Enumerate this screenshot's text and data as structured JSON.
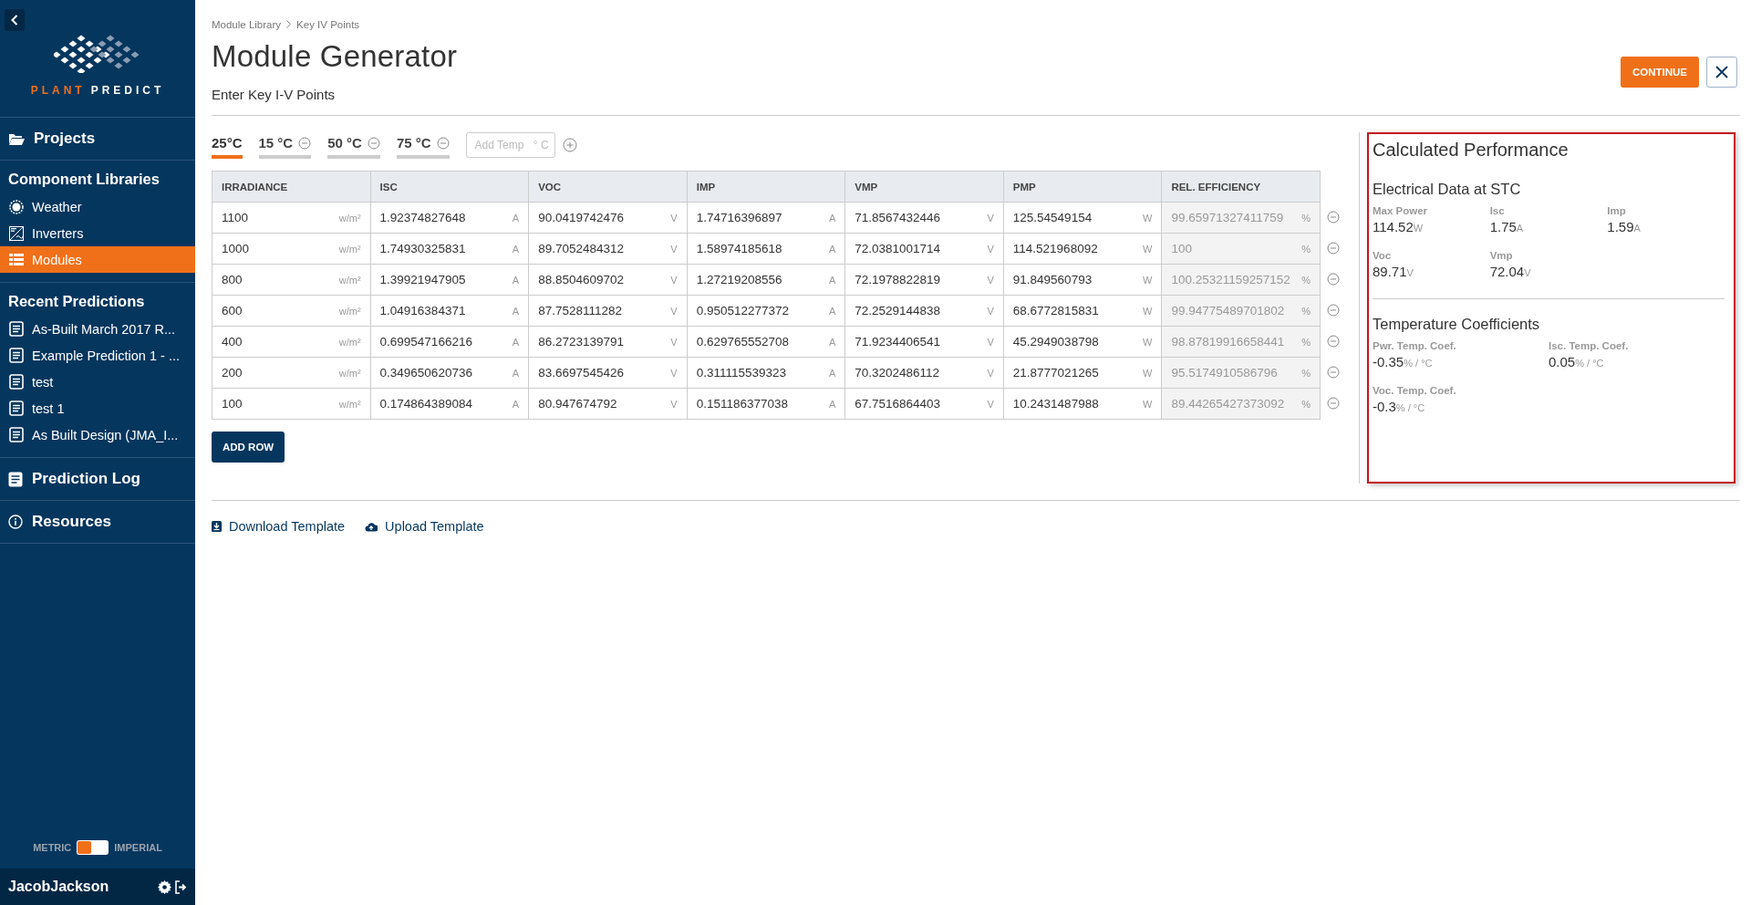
{
  "sidebar": {
    "logo": {
      "first": "PLANT",
      "second": "PREDICT"
    },
    "sections": [
      {
        "kind": "link",
        "label": "Projects",
        "selected": false
      },
      {
        "kind": "group",
        "label": "Component Libraries",
        "items": [
          {
            "label": "Weather",
            "selected": false
          },
          {
            "label": "Inverters",
            "selected": false
          },
          {
            "label": "Modules",
            "selected": true
          }
        ]
      },
      {
        "kind": "group",
        "label": "Recent Predictions",
        "items": [
          {
            "label": "As-Built March 2017 R...",
            "selected": false
          },
          {
            "label": "Example Prediction 1 - ...",
            "selected": false
          },
          {
            "label": "test",
            "selected": false
          },
          {
            "label": "test 1",
            "selected": false
          },
          {
            "label": "As Built Design (JMA_I...",
            "selected": false
          }
        ]
      },
      {
        "kind": "link",
        "label": "Prediction Log",
        "selected": false
      },
      {
        "kind": "link",
        "label": "Resources",
        "selected": false
      }
    ],
    "units": {
      "left_label": "METRIC",
      "right_label": "IMPERIAL",
      "imperial": false
    },
    "user": "JacobJackson"
  },
  "breadcrumb": [
    "Module Library",
    "Key IV Points"
  ],
  "title": "Module Generator",
  "subtitle": "Enter Key I-V Points",
  "continue_button": "CONTINUE",
  "temperature_tabs": [
    {
      "label": "25°C",
      "selected": true,
      "removable": false
    },
    {
      "label": "15 °C",
      "selected": false,
      "removable": true
    },
    {
      "label": "50 °C",
      "selected": false,
      "removable": true
    },
    {
      "label": "75 °C",
      "selected": false,
      "removable": true
    }
  ],
  "add_temp": {
    "placeholder": "Add Temp",
    "suffix": "° C"
  },
  "table": {
    "columns": [
      {
        "label": "IRRADIANCE",
        "readonly": false
      },
      {
        "label": "ISC",
        "readonly": false
      },
      {
        "label": "VOC",
        "readonly": false
      },
      {
        "label": "IMP",
        "readonly": false
      },
      {
        "label": "VMP",
        "readonly": false
      },
      {
        "label": "PMP",
        "readonly": false
      },
      {
        "label": "REL. EFFICIENCY",
        "readonly": true
      }
    ],
    "rows": [
      [
        {
          "value": "1100",
          "unit": "w/m²"
        },
        {
          "value": "1.92374827648",
          "unit": "A"
        },
        {
          "value": "90.0419742476",
          "unit": "V"
        },
        {
          "value": "1.74716396897",
          "unit": "A"
        },
        {
          "value": "71.8567432446",
          "unit": "V"
        },
        {
          "value": "125.54549154",
          "unit": "W"
        },
        {
          "value": "99.65971327411759",
          "unit": "%"
        }
      ],
      [
        {
          "value": "1000",
          "unit": "w/m²"
        },
        {
          "value": "1.74930325831",
          "unit": "A"
        },
        {
          "value": "89.7052484312",
          "unit": "V"
        },
        {
          "value": "1.58974185618",
          "unit": "A"
        },
        {
          "value": "72.0381001714",
          "unit": "V"
        },
        {
          "value": "114.521968092",
          "unit": "W"
        },
        {
          "value": "100",
          "unit": "%"
        }
      ],
      [
        {
          "value": "800",
          "unit": "w/m²"
        },
        {
          "value": "1.39921947905",
          "unit": "A"
        },
        {
          "value": "88.8504609702",
          "unit": "V"
        },
        {
          "value": "1.27219208556",
          "unit": "A"
        },
        {
          "value": "72.1978822819",
          "unit": "V"
        },
        {
          "value": "91.849560793",
          "unit": "W"
        },
        {
          "value": "100.25321159257152",
          "unit": "%"
        }
      ],
      [
        {
          "value": "600",
          "unit": "w/m²"
        },
        {
          "value": "1.04916384371",
          "unit": "A"
        },
        {
          "value": "87.7528111282",
          "unit": "V"
        },
        {
          "value": "0.950512277372",
          "unit": "A"
        },
        {
          "value": "72.2529144838",
          "unit": "V"
        },
        {
          "value": "68.6772815831",
          "unit": "W"
        },
        {
          "value": "99.94775489701802",
          "unit": "%"
        }
      ],
      [
        {
          "value": "400",
          "unit": "w/m²"
        },
        {
          "value": "0.699547166216",
          "unit": "A"
        },
        {
          "value": "86.2723139791",
          "unit": "V"
        },
        {
          "value": "0.629765552708",
          "unit": "A"
        },
        {
          "value": "71.9234406541",
          "unit": "V"
        },
        {
          "value": "45.2949038798",
          "unit": "W"
        },
        {
          "value": "98.87819916658441",
          "unit": "%"
        }
      ],
      [
        {
          "value": "200",
          "unit": "w/m²"
        },
        {
          "value": "0.349650620736",
          "unit": "A"
        },
        {
          "value": "83.6697545426",
          "unit": "V"
        },
        {
          "value": "0.311115539323",
          "unit": "A"
        },
        {
          "value": "70.3202486112",
          "unit": "V"
        },
        {
          "value": "21.8777021265",
          "unit": "W"
        },
        {
          "value": "95.5174910586796",
          "unit": "%"
        }
      ],
      [
        {
          "value": "100",
          "unit": "w/m²"
        },
        {
          "value": "0.174864389084",
          "unit": "A"
        },
        {
          "value": "80.947674792",
          "unit": "V"
        },
        {
          "value": "0.151186377038",
          "unit": "A"
        },
        {
          "value": "67.7516864403",
          "unit": "V"
        },
        {
          "value": "10.2431487988",
          "unit": "W"
        },
        {
          "value": "89.44265427373092",
          "unit": "%"
        }
      ]
    ]
  },
  "add_row_button": "ADD ROW",
  "links": [
    "Download Template",
    "Upload Template"
  ],
  "performance": {
    "title": "Calculated Performance",
    "highlighted": true,
    "sections": [
      {
        "title": "Electrical Data at STC",
        "items": [
          {
            "label": "Max Power",
            "value": "114.52",
            "unit": "W"
          },
          {
            "label": "Isc",
            "value": "1.75",
            "unit": "A"
          },
          {
            "label": "Imp",
            "value": "1.59",
            "unit": "A"
          },
          {
            "label": "Voc",
            "value": "89.71",
            "unit": "V"
          },
          {
            "label": "Vmp",
            "value": "72.04",
            "unit": "V"
          }
        ]
      },
      {
        "title": "Temperature Coefficients",
        "items": [
          {
            "label": "Pwr. Temp. Coef.",
            "value": "-0.35",
            "unit": "% / °C"
          },
          {
            "label": "Isc. Temp. Coef.",
            "value": "0.05",
            "unit": "% / °C"
          },
          {
            "label": "Voc. Temp. Coef.",
            "value": "-0.3",
            "unit": "% / °C"
          }
        ]
      }
    ]
  }
}
